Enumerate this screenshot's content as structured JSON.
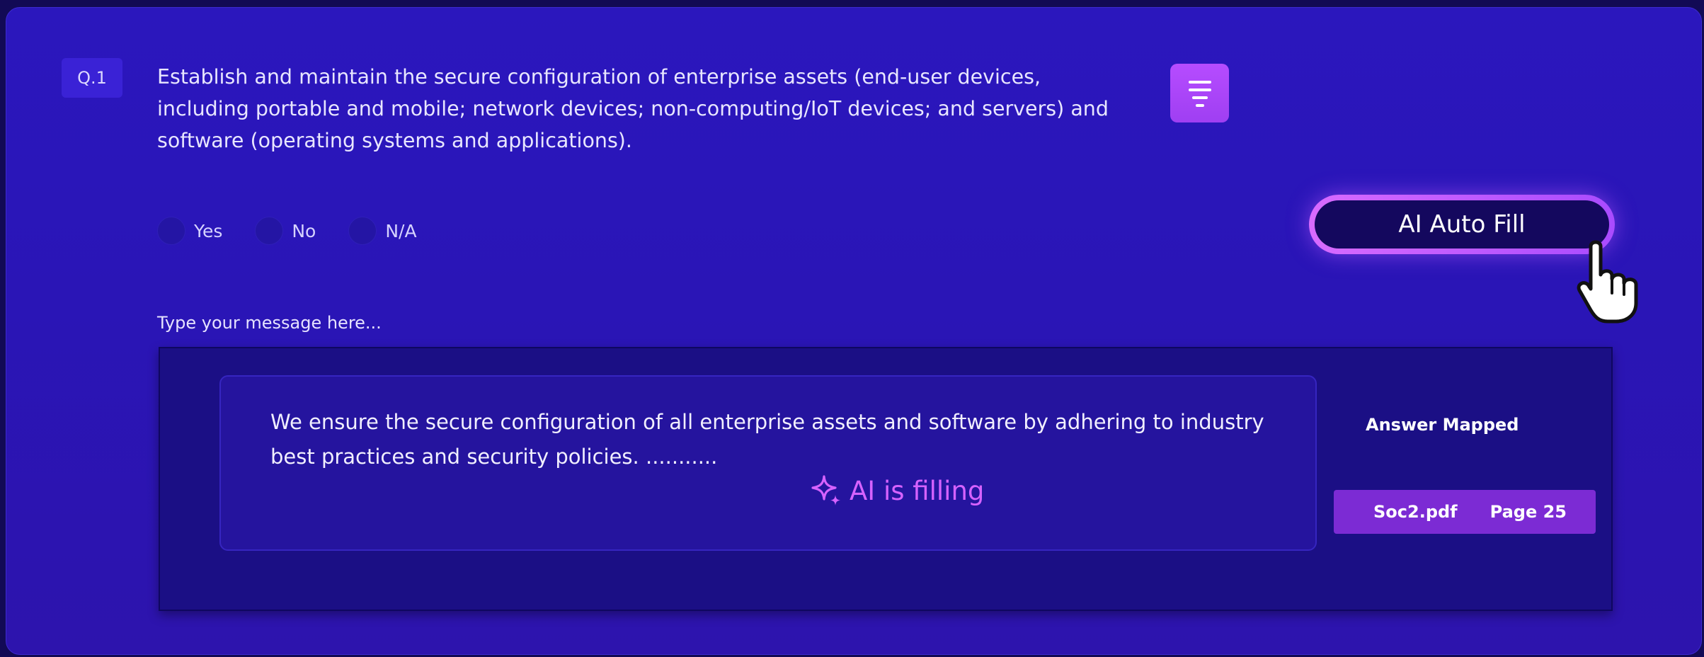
{
  "question": {
    "number": "Q.1",
    "text": "Establish and maintain the secure configuration of enterprise assets (end-user devices, including portable and mobile; network devices; non-computing/IoT devices; and servers) and software (operating systems and applications)."
  },
  "answer_options": [
    {
      "label": "Yes"
    },
    {
      "label": "No"
    },
    {
      "label": "N/A"
    }
  ],
  "ai_button": {
    "label": "AI Auto Fill"
  },
  "message": {
    "label": "Type your message here...",
    "text": "We ensure the secure configuration of all enterprise assets and software by adhering to industry best practices and security policies. ...........",
    "status": "AI is filling"
  },
  "mapping": {
    "label": "Answer Mapped",
    "file": "Soc2.pdf",
    "page": "Page 25"
  },
  "icons": {
    "menu": "menu-lines-icon",
    "sparkle": "sparkle-icon",
    "cursor": "hand-pointer-icon"
  },
  "colors": {
    "background": "#2b17bd",
    "accent": "#b64cff",
    "ai_text": "#d662ff",
    "chip": "#7c2bd4"
  }
}
